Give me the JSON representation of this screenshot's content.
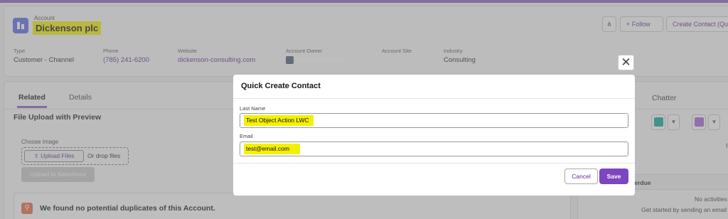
{
  "header": {
    "object_type": "Account",
    "account_name": "Dickenson plc",
    "buttons": {
      "follow": "+ Follow",
      "create_contact": "Create Contact (Qui"
    }
  },
  "fields": [
    {
      "label": "Type",
      "value": "Customer - Channel"
    },
    {
      "label": "Phone",
      "value": "(785) 241-6200"
    },
    {
      "label": "Website",
      "value": "dickenson-consulting.com"
    },
    {
      "label": "Account Owner",
      "value": ""
    },
    {
      "label": "Account Site",
      "value": ""
    },
    {
      "label": "Industry",
      "value": "Consulting"
    }
  ],
  "tabs": {
    "related": "Related",
    "details": "Details",
    "chatter": "Chatter"
  },
  "file_upload": {
    "title": "File Upload with Preview",
    "choose_label": "Choose Image",
    "upload_button": "Upload Files",
    "drop_text": "Or drop files",
    "upload_sf_button": "Upload to Salesforce"
  },
  "duplicates_message": "We found no potential duplicates of this Account.",
  "activity": {
    "right_letter": "F",
    "section_title": "g & Overdue",
    "no_activities": "No activities",
    "get_started": "Get started by sending an email"
  },
  "modal": {
    "title": "Quick Create Contact",
    "last_name_label": "Last Name",
    "last_name_value": "Test Object Action LWC",
    "email_label": "Email",
    "email_value": "test@email.com",
    "cancel": "Cancel",
    "save": "Save"
  },
  "colors": {
    "brand": "#7c46c0",
    "highlight": "#f5f000",
    "account_icon": "#5867e8"
  }
}
